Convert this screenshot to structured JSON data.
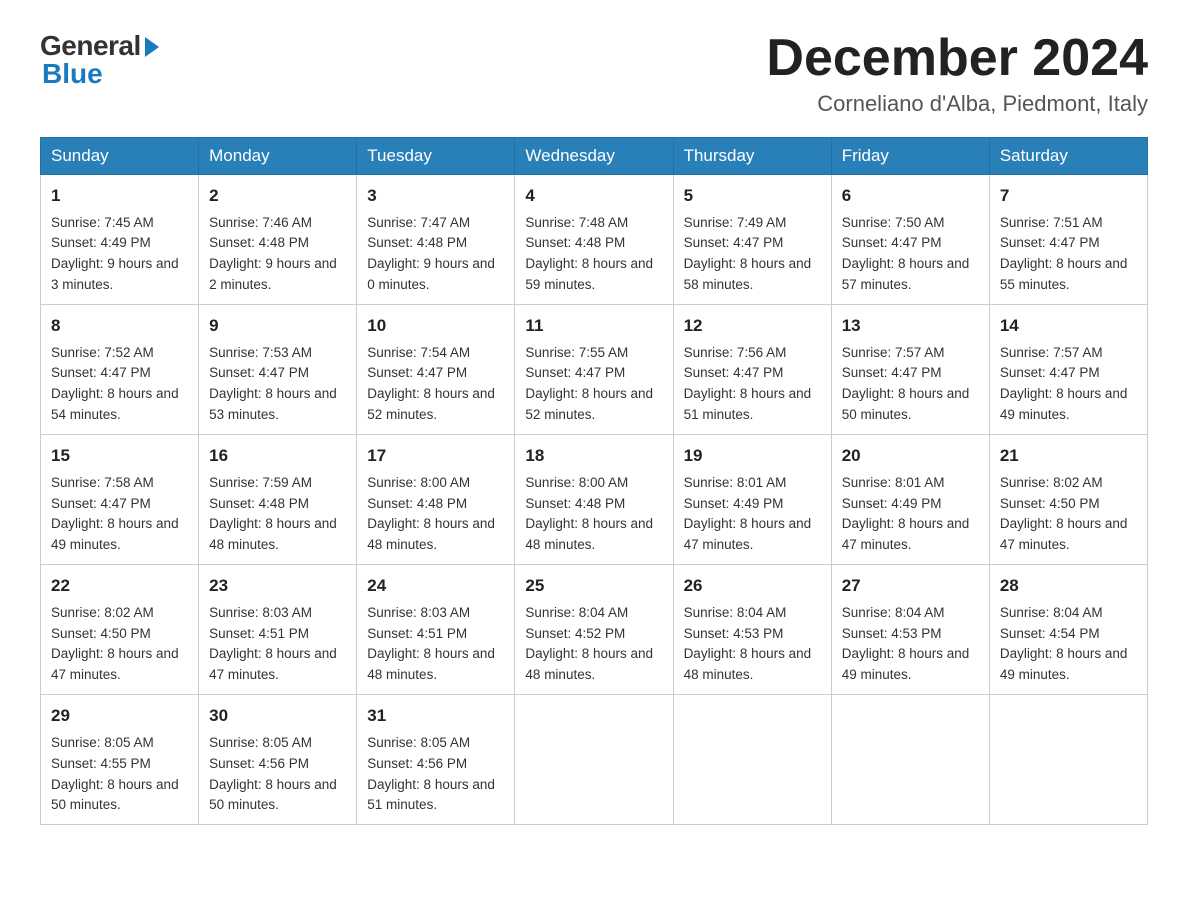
{
  "header": {
    "logo_general": "General",
    "logo_blue": "Blue",
    "month_title": "December 2024",
    "location": "Corneliano d'Alba, Piedmont, Italy"
  },
  "days_of_week": [
    "Sunday",
    "Monday",
    "Tuesday",
    "Wednesday",
    "Thursday",
    "Friday",
    "Saturday"
  ],
  "weeks": [
    [
      {
        "day": "1",
        "sunrise": "7:45 AM",
        "sunset": "4:49 PM",
        "daylight": "9 hours and 3 minutes."
      },
      {
        "day": "2",
        "sunrise": "7:46 AM",
        "sunset": "4:48 PM",
        "daylight": "9 hours and 2 minutes."
      },
      {
        "day": "3",
        "sunrise": "7:47 AM",
        "sunset": "4:48 PM",
        "daylight": "9 hours and 0 minutes."
      },
      {
        "day": "4",
        "sunrise": "7:48 AM",
        "sunset": "4:48 PM",
        "daylight": "8 hours and 59 minutes."
      },
      {
        "day": "5",
        "sunrise": "7:49 AM",
        "sunset": "4:47 PM",
        "daylight": "8 hours and 58 minutes."
      },
      {
        "day": "6",
        "sunrise": "7:50 AM",
        "sunset": "4:47 PM",
        "daylight": "8 hours and 57 minutes."
      },
      {
        "day": "7",
        "sunrise": "7:51 AM",
        "sunset": "4:47 PM",
        "daylight": "8 hours and 55 minutes."
      }
    ],
    [
      {
        "day": "8",
        "sunrise": "7:52 AM",
        "sunset": "4:47 PM",
        "daylight": "8 hours and 54 minutes."
      },
      {
        "day": "9",
        "sunrise": "7:53 AM",
        "sunset": "4:47 PM",
        "daylight": "8 hours and 53 minutes."
      },
      {
        "day": "10",
        "sunrise": "7:54 AM",
        "sunset": "4:47 PM",
        "daylight": "8 hours and 52 minutes."
      },
      {
        "day": "11",
        "sunrise": "7:55 AM",
        "sunset": "4:47 PM",
        "daylight": "8 hours and 52 minutes."
      },
      {
        "day": "12",
        "sunrise": "7:56 AM",
        "sunset": "4:47 PM",
        "daylight": "8 hours and 51 minutes."
      },
      {
        "day": "13",
        "sunrise": "7:57 AM",
        "sunset": "4:47 PM",
        "daylight": "8 hours and 50 minutes."
      },
      {
        "day": "14",
        "sunrise": "7:57 AM",
        "sunset": "4:47 PM",
        "daylight": "8 hours and 49 minutes."
      }
    ],
    [
      {
        "day": "15",
        "sunrise": "7:58 AM",
        "sunset": "4:47 PM",
        "daylight": "8 hours and 49 minutes."
      },
      {
        "day": "16",
        "sunrise": "7:59 AM",
        "sunset": "4:48 PM",
        "daylight": "8 hours and 48 minutes."
      },
      {
        "day": "17",
        "sunrise": "8:00 AM",
        "sunset": "4:48 PM",
        "daylight": "8 hours and 48 minutes."
      },
      {
        "day": "18",
        "sunrise": "8:00 AM",
        "sunset": "4:48 PM",
        "daylight": "8 hours and 48 minutes."
      },
      {
        "day": "19",
        "sunrise": "8:01 AM",
        "sunset": "4:49 PM",
        "daylight": "8 hours and 47 minutes."
      },
      {
        "day": "20",
        "sunrise": "8:01 AM",
        "sunset": "4:49 PM",
        "daylight": "8 hours and 47 minutes."
      },
      {
        "day": "21",
        "sunrise": "8:02 AM",
        "sunset": "4:50 PM",
        "daylight": "8 hours and 47 minutes."
      }
    ],
    [
      {
        "day": "22",
        "sunrise": "8:02 AM",
        "sunset": "4:50 PM",
        "daylight": "8 hours and 47 minutes."
      },
      {
        "day": "23",
        "sunrise": "8:03 AM",
        "sunset": "4:51 PM",
        "daylight": "8 hours and 47 minutes."
      },
      {
        "day": "24",
        "sunrise": "8:03 AM",
        "sunset": "4:51 PM",
        "daylight": "8 hours and 48 minutes."
      },
      {
        "day": "25",
        "sunrise": "8:04 AM",
        "sunset": "4:52 PM",
        "daylight": "8 hours and 48 minutes."
      },
      {
        "day": "26",
        "sunrise": "8:04 AM",
        "sunset": "4:53 PM",
        "daylight": "8 hours and 48 minutes."
      },
      {
        "day": "27",
        "sunrise": "8:04 AM",
        "sunset": "4:53 PM",
        "daylight": "8 hours and 49 minutes."
      },
      {
        "day": "28",
        "sunrise": "8:04 AM",
        "sunset": "4:54 PM",
        "daylight": "8 hours and 49 minutes."
      }
    ],
    [
      {
        "day": "29",
        "sunrise": "8:05 AM",
        "sunset": "4:55 PM",
        "daylight": "8 hours and 50 minutes."
      },
      {
        "day": "30",
        "sunrise": "8:05 AM",
        "sunset": "4:56 PM",
        "daylight": "8 hours and 50 minutes."
      },
      {
        "day": "31",
        "sunrise": "8:05 AM",
        "sunset": "4:56 PM",
        "daylight": "8 hours and 51 minutes."
      },
      null,
      null,
      null,
      null
    ]
  ]
}
